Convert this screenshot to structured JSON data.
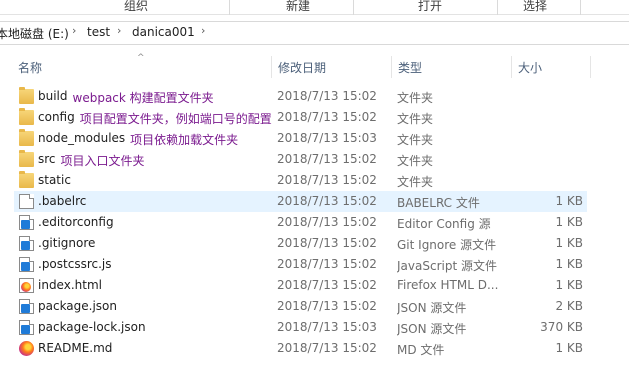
{
  "ribbon": {
    "groups": [
      "组织",
      "新建",
      "打开",
      "选择"
    ]
  },
  "address": {
    "crumbs": [
      "本地磁盘 (E:)",
      "test",
      "danica001"
    ],
    "separator": "›"
  },
  "columns": {
    "name": "名称",
    "date": "修改日期",
    "type": "类型",
    "size": "大小",
    "sort_indicator": "^"
  },
  "files": [
    {
      "name": "build",
      "annotation": "webpack 构建配置文件夹",
      "date": "2018/7/13 15:02",
      "type": "文件夹",
      "size": "",
      "icon": "folder-icon"
    },
    {
      "name": "config",
      "annotation": "项目配置文件夹，例如端口号的配置",
      "date": "2018/7/13 15:02",
      "type": "文件夹",
      "size": "",
      "icon": "folder-icon"
    },
    {
      "name": "node_modules",
      "annotation": "项目依赖加载文件夹",
      "date": "2018/7/13 15:03",
      "type": "文件夹",
      "size": "",
      "icon": "folder-icon"
    },
    {
      "name": "src",
      "annotation": "项目入口文件夹",
      "date": "2018/7/13 15:02",
      "type": "文件夹",
      "size": "",
      "icon": "folder-icon"
    },
    {
      "name": "static",
      "annotation": "",
      "date": "2018/7/13 15:02",
      "type": "文件夹",
      "size": "",
      "icon": "folder-icon"
    },
    {
      "name": ".babelrc",
      "annotation": "",
      "date": "2018/7/13 15:02",
      "type": "BABELRC 文件",
      "size": "1 KB",
      "icon": "generic-file-icon"
    },
    {
      "name": ".editorconfig",
      "annotation": "",
      "date": "2018/7/13 15:02",
      "type": "Editor Config 源",
      "size": "1 KB",
      "icon": "vscode-file-icon"
    },
    {
      "name": ".gitignore",
      "annotation": "",
      "date": "2018/7/13 15:02",
      "type": "Git Ignore 源文件",
      "size": "1 KB",
      "icon": "vscode-file-icon"
    },
    {
      "name": ".postcssrc.js",
      "annotation": "",
      "date": "2018/7/13 15:02",
      "type": "JavaScript 源文件",
      "size": "1 KB",
      "icon": "vscode-file-icon"
    },
    {
      "name": "index.html",
      "annotation": "",
      "date": "2018/7/13 15:02",
      "type": "Firefox HTML D...",
      "size": "1 KB",
      "icon": "firefox-html-icon"
    },
    {
      "name": "package.json",
      "annotation": "",
      "date": "2018/7/13 15:02",
      "type": "JSON 源文件",
      "size": "2 KB",
      "icon": "vscode-file-icon"
    },
    {
      "name": "package-lock.json",
      "annotation": "",
      "date": "2018/7/13 15:03",
      "type": "JSON 源文件",
      "size": "370 KB",
      "icon": "vscode-file-icon"
    },
    {
      "name": "README.md",
      "annotation": "",
      "date": "2018/7/13 15:02",
      "type": "MD 文件",
      "size": "1 KB",
      "icon": "firefox-icon"
    }
  ],
  "selected_index": 5,
  "colors": {
    "selection": "#e5f3ff",
    "annotation": "#7b1b8f",
    "header_text": "#4c607a"
  }
}
